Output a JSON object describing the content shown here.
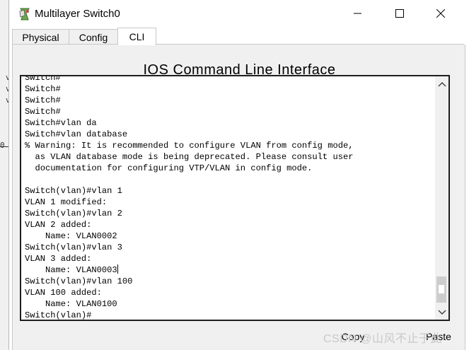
{
  "window": {
    "title": "Multilayer Switch0",
    "minimize_label": "minimize",
    "maximize_label": "maximize",
    "close_label": "close"
  },
  "tabs": [
    {
      "label": "Physical",
      "active": false
    },
    {
      "label": "Config",
      "active": false
    },
    {
      "label": "CLI",
      "active": true
    }
  ],
  "cli": {
    "heading": "IOS Command Line Interface",
    "lines": [
      "Switch#",
      "Switch#",
      "Switch#",
      "Switch#",
      "Switch#vlan da",
      "Switch#vlan database",
      "% Warning: It is recommended to configure VLAN from config mode,",
      "  as VLAN database mode is being deprecated. Please consult user",
      "  documentation for configuring VTP/VLAN in config mode.",
      "",
      "Switch(vlan)#vlan 1",
      "VLAN 1 modified:",
      "Switch(vlan)#vlan 2",
      "VLAN 2 added:",
      "    Name: VLAN0002",
      "Switch(vlan)#vlan 3",
      "VLAN 3 added:",
      "    Name: VLAN0003",
      "Switch(vlan)#vlan 100",
      "VLAN 100 added:",
      "    Name: VLAN0100",
      "Switch(vlan)#"
    ],
    "scroll_position": 1.0
  },
  "buttons": {
    "copy": "Copy",
    "paste": "Paste"
  },
  "watermark": "CSDN @山风不止于此",
  "left_strip": [
    "v",
    "v",
    "v",
    "0"
  ]
}
